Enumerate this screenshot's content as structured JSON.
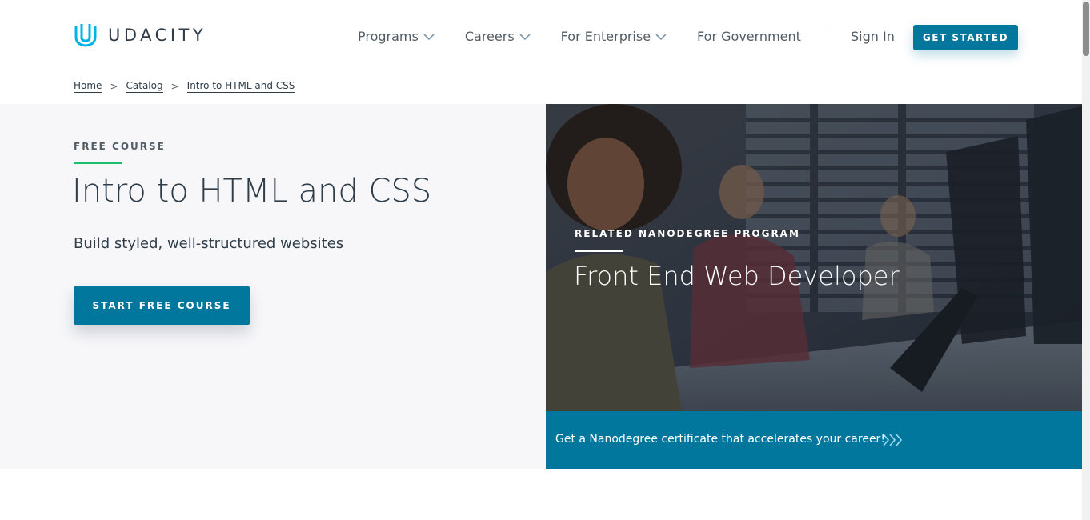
{
  "brand": {
    "name": "UDACITY",
    "logo_icon": "udacity-u-logo",
    "accent": "#02b3e4"
  },
  "nav": {
    "items": [
      {
        "label": "Programs",
        "has_dropdown": true
      },
      {
        "label": "Careers",
        "has_dropdown": true
      },
      {
        "label": "For Enterprise",
        "has_dropdown": true
      },
      {
        "label": "For Government",
        "has_dropdown": false
      }
    ],
    "sign_in": "Sign In",
    "cta": "GET STARTED"
  },
  "breadcrumb": [
    "Home",
    "Catalog",
    "Intro to HTML and CSS"
  ],
  "hero": {
    "eyebrow": "FREE COURSE",
    "title": "Intro to HTML and CSS",
    "subtitle": "Build styled, well-structured websites",
    "button": "START FREE COURSE"
  },
  "related": {
    "eyebrow": "RELATED NANODEGREE PROGRAM",
    "title": "Front End Web Developer",
    "cta": "Get a Nanodegree certificate that accelerates your career!",
    "cta_icon": "triple-chevron-right-icon"
  },
  "colors": {
    "primary": "#02779e",
    "eyebrow_bar": "#15c26b",
    "text": "#2e3d49"
  }
}
